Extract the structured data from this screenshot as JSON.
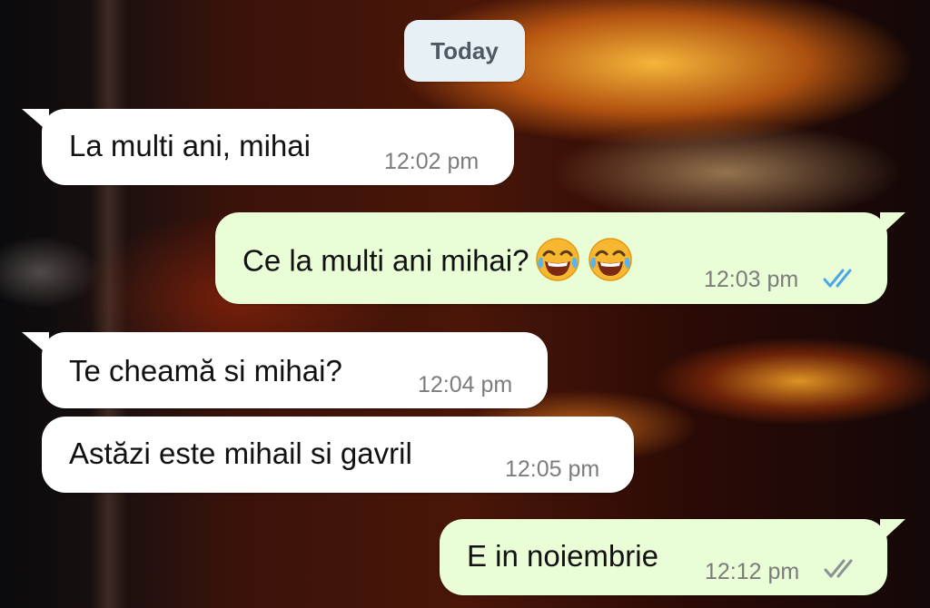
{
  "date_chip": "Today",
  "messages": [
    {
      "text": "La multi ani, mihai",
      "time": "12:02 pm",
      "direction": "incoming"
    },
    {
      "text": "Ce la multi ani mihai?",
      "time": "12:03 pm",
      "direction": "outgoing",
      "emoji": [
        "face-with-tears-of-joy-icon",
        "face-with-tears-of-joy-icon"
      ],
      "status": "read"
    },
    {
      "text": "Te cheamă si mihai?",
      "time": "12:04 pm",
      "direction": "incoming"
    },
    {
      "text": "Astăzi este mihail si gavril",
      "time": "12:05 pm",
      "direction": "incoming"
    },
    {
      "text": "E in noiembrie",
      "time": "12:12 pm",
      "direction": "outgoing",
      "status": "delivered"
    }
  ],
  "colors": {
    "incoming_bubble": "#ffffff",
    "outgoing_bubble": "#e9fdd6",
    "read_tick": "#4fa6e6",
    "delivered_tick": "#8a9296",
    "time_text": "#7c7c7c",
    "date_chip_bg": "#e7f0f5"
  }
}
